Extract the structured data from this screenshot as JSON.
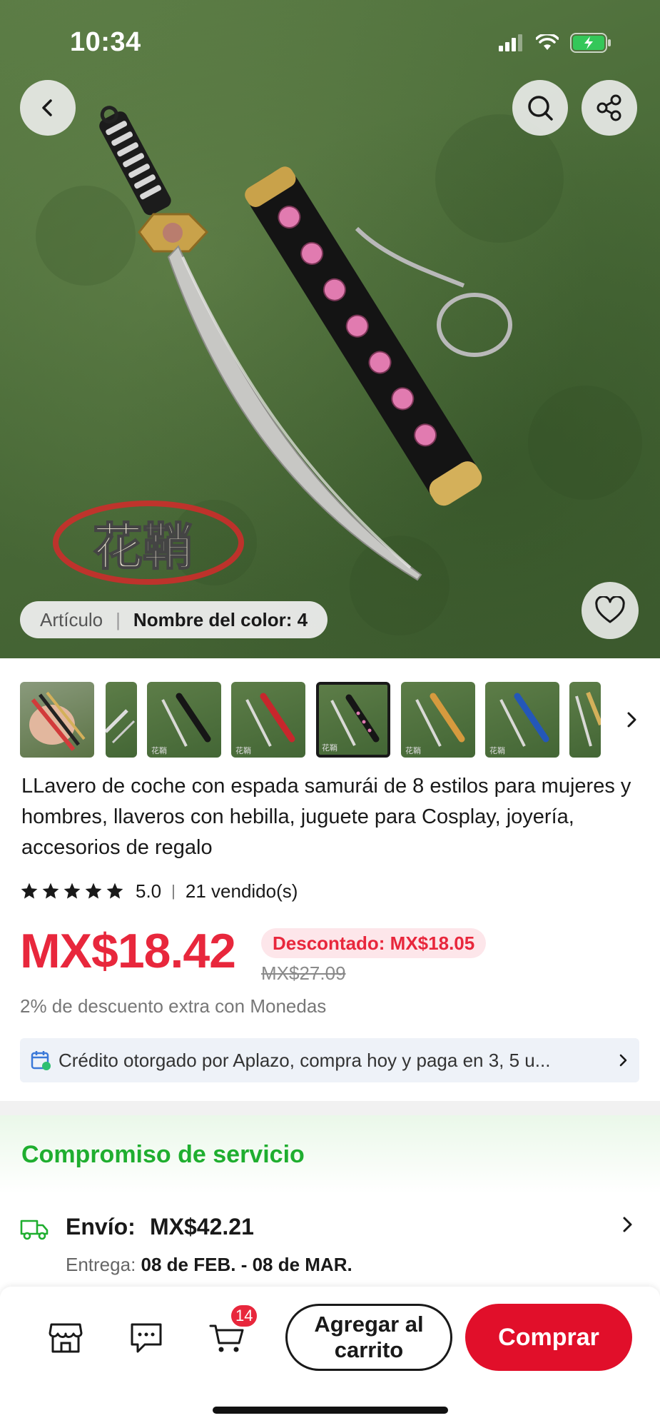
{
  "status_bar": {
    "time": "10:34"
  },
  "hero": {
    "variant_label": "Artículo",
    "variant_value": "Nombre del color: 4",
    "watermark": "花鞘"
  },
  "thumbnails": {
    "count": 9,
    "selected_index": 4,
    "watermark": "花鞘"
  },
  "product": {
    "title": "LLavero de coche con espada samurái de 8 estilos para mujeres y hombres, llaveros con hebilla, juguete para Cosplay, joyería, accesorios de regalo",
    "rating": "5.0",
    "sold": "21 vendido(s)",
    "price": "MX$18.42",
    "discount_label": "Descontado: MX$18.05",
    "original_price": "MX$27.09",
    "coins_text": "2% de descuento extra con Monedas",
    "credit_text": "Crédito otorgado por Aplazo, compra hoy y paga en 3, 5 u..."
  },
  "service": {
    "title": "Compromiso de servicio",
    "shipping_label": "Envío:",
    "shipping_price": "MX$42.21",
    "delivery_label": "Entrega:",
    "delivery_dates": "08 de FEB. - 08 de MAR."
  },
  "bottom_bar": {
    "cart_count": "14",
    "add_to_cart_label": "Agregar al carrito",
    "buy_label": "Comprar"
  },
  "colors": {
    "price_red": "#e8273c",
    "buy_red": "#e10f2a",
    "service_green": "#1fae2f",
    "hero_green": "#4a6b38"
  },
  "icons": [
    "back-icon",
    "search-icon",
    "share-icon",
    "heart-icon",
    "star-icon",
    "calendar-icon",
    "truck-icon",
    "store-icon",
    "chat-icon",
    "cart-icon",
    "chevron-right-icon"
  ]
}
